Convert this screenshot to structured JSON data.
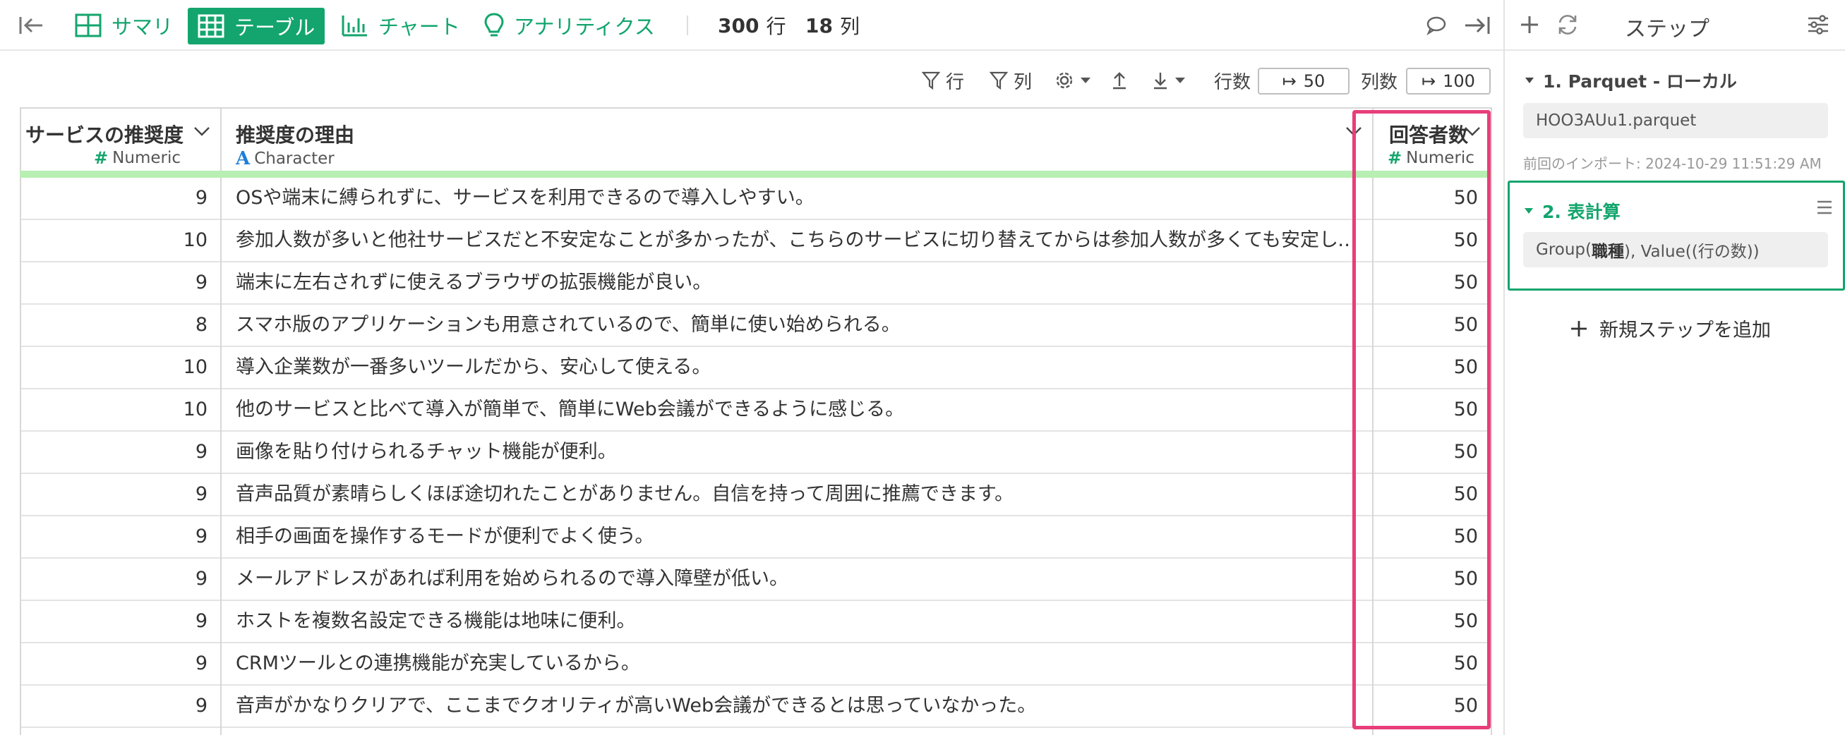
{
  "toolbar": {
    "tabs": [
      {
        "label": "サマリ",
        "active": false
      },
      {
        "label": "テーブル",
        "active": true
      },
      {
        "label": "チャート",
        "active": false
      },
      {
        "label": "アナリティクス",
        "active": false
      }
    ],
    "row_count": "300",
    "row_unit": "行",
    "col_count": "18",
    "col_unit": "列"
  },
  "subtoolbar": {
    "row_filter": "行",
    "col_filter": "列",
    "rows_label": "行数",
    "rows_value": "50",
    "cols_label": "列数",
    "cols_value": "100"
  },
  "table": {
    "columns": [
      {
        "name": "サービスの推奨度",
        "type": "Numeric"
      },
      {
        "name": "推奨度の理由",
        "type": "Character"
      },
      {
        "name": "回答者数",
        "type": "Numeric"
      }
    ],
    "rows": [
      [
        "9",
        "OSや端末に縛られずに、サービスを利用できるので導入しやすい。",
        "50"
      ],
      [
        "10",
        "参加人数が多いと他社サービスだと不安定なことが多かったが、こちらのサービスに切り替えてからは参加人数が多くても安定している。",
        "50"
      ],
      [
        "9",
        "端末に左右されずに使えるブラウザの拡張機能が良い。",
        "50"
      ],
      [
        "8",
        "スマホ版のアプリケーションも用意されているので、簡単に使い始められる。",
        "50"
      ],
      [
        "10",
        "導入企業数が一番多いツールだから、安心して使える。",
        "50"
      ],
      [
        "10",
        "他のサービスと比べて導入が簡単で、簡単にWeb会議ができるように感じる。",
        "50"
      ],
      [
        "9",
        "画像を貼り付けられるチャット機能が便利。",
        "50"
      ],
      [
        "9",
        "音声品質が素晴らしくほぼ途切れたことがありません。自信を持って周囲に推薦できます。",
        "50"
      ],
      [
        "9",
        "相手の画面を操作するモードが便利でよく使う。",
        "50"
      ],
      [
        "9",
        "メールアドレスがあれば利用を始められるので導入障壁が低い。",
        "50"
      ],
      [
        "9",
        "ホストを複数名設定できる機能は地味に便利。",
        "50"
      ],
      [
        "9",
        "CRMツールとの連携機能が充実しているから。",
        "50"
      ],
      [
        "9",
        "音声がかなりクリアで、ここまでクオリティが高いWeb会議ができるとは思っていなかった。",
        "50"
      ]
    ]
  },
  "panel": {
    "title": "ステップ",
    "steps": [
      {
        "title": "1. Parquet - ローカル",
        "detail": "HOO3AUu1.parquet",
        "note": "前回のインポート: 2024-10-29 11:51:29 AM"
      },
      {
        "title": "2. 表計算",
        "detail_prefix": "Group(",
        "detail_bold": "職種",
        "detail_suffix": "), Value((行の数))"
      }
    ],
    "add_step": "新規ステップを追加"
  },
  "colors": {
    "accent": "#13a56d",
    "highlight": "#e83e7a",
    "header_bar": "#b8efb3"
  }
}
